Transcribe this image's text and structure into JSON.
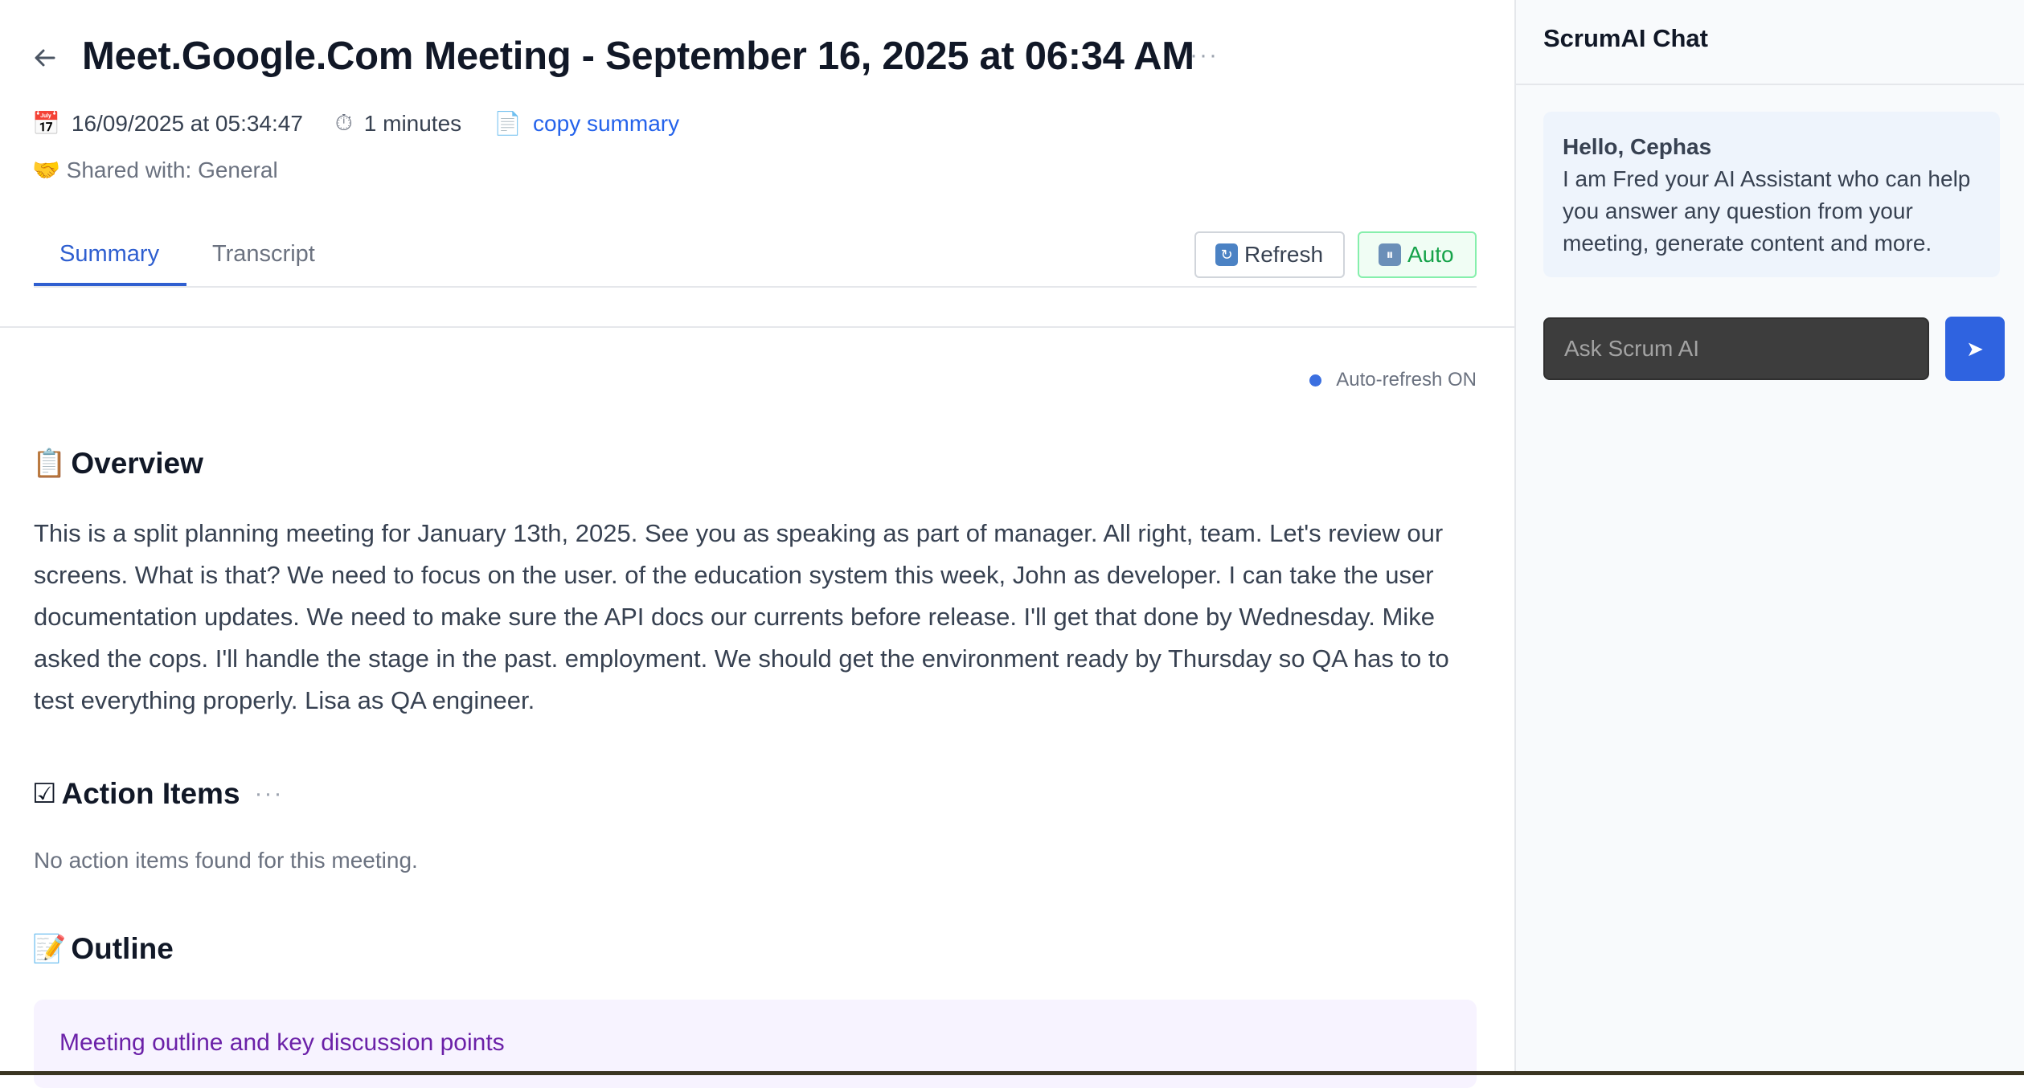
{
  "header": {
    "back_icon": "arrow-left-icon",
    "title": "Meet.Google.Com Meeting - September 16, 2025 at 06:34 AM",
    "more_label": "···"
  },
  "meta": {
    "date_icon": "📅",
    "datetime": "16/09/2025 at 05:34:47",
    "duration_icon": "⏱",
    "duration": "1 minutes",
    "copy_icon": "📄",
    "copy_summary_label": "copy summary",
    "shared": "🤝 Shared with: General"
  },
  "tabs": [
    {
      "label": "Summary",
      "active": true
    },
    {
      "label": "Transcript",
      "active": false
    }
  ],
  "toolbar": {
    "refresh_glyph": "↻",
    "refresh_label": "Refresh",
    "auto_glyph": "⏸",
    "auto_label": "Auto"
  },
  "status": {
    "auto_refresh": "Auto-refresh ON"
  },
  "overview": {
    "emoji": "📋",
    "title": "Overview",
    "body": "This is a split planning meeting for January 13th, 2025. See you as speaking as part of manager. All right, team. Let's review our screens. What is that? We need to focus on the user. of the education system this week, John as developer. I can take the user documentation updates. We need to make sure the API docs our currents before release. I'll get that done by Wednesday. Mike asked the cops. I'll handle the stage in the past. employment. We should get the environment ready by Thursday so QA has to to test everything properly. Lisa as QA engineer."
  },
  "action_items": {
    "emoji": "☑",
    "title": "Action Items",
    "more_label": "···",
    "empty_text": "No action items found for this meeting."
  },
  "outline": {
    "emoji": "📝",
    "title": "Outline",
    "box_text": "Meeting outline and key discussion points"
  },
  "chat": {
    "title": "ScrumAI Chat",
    "greeting": "Hello, Cephas",
    "message": "I am Fred your AI Assistant who can help you answer any question from your meeting, generate content and more.",
    "input_placeholder": "Ask Scrum AI",
    "send_glyph": "➤"
  },
  "colors": {
    "accent": "#2f5fd0",
    "auto_green": "#16a34a",
    "send_blue": "#2f63e0",
    "outline_purple": "#6b21a8"
  }
}
